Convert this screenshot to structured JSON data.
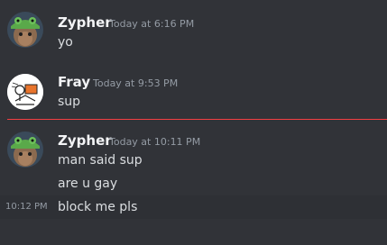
{
  "messages": [
    {
      "author": "Zypher",
      "avatar": "zypher-frog-hat-cat-avatar",
      "timestamp": "Today at 6:16 PM",
      "lines": [
        "yo"
      ]
    },
    {
      "author": "Fray",
      "avatar": "fray-sketch-avatar",
      "timestamp": "Today at 9:53 PM",
      "lines": [
        "sup"
      ]
    },
    {
      "author": "Zypher",
      "avatar": "zypher-frog-hat-cat-avatar",
      "timestamp": "Today at 10:11 PM",
      "lines": [
        "man said sup",
        "are u gay",
        "block me pls"
      ],
      "hover_time": "10:12 PM"
    }
  ],
  "colors": {
    "background": "#313338",
    "username": "#f2f3f5",
    "text": "#dbdee1",
    "timestamp": "#949ba4",
    "new_divider": "#f23f43",
    "hover_row": "#2e3035"
  }
}
